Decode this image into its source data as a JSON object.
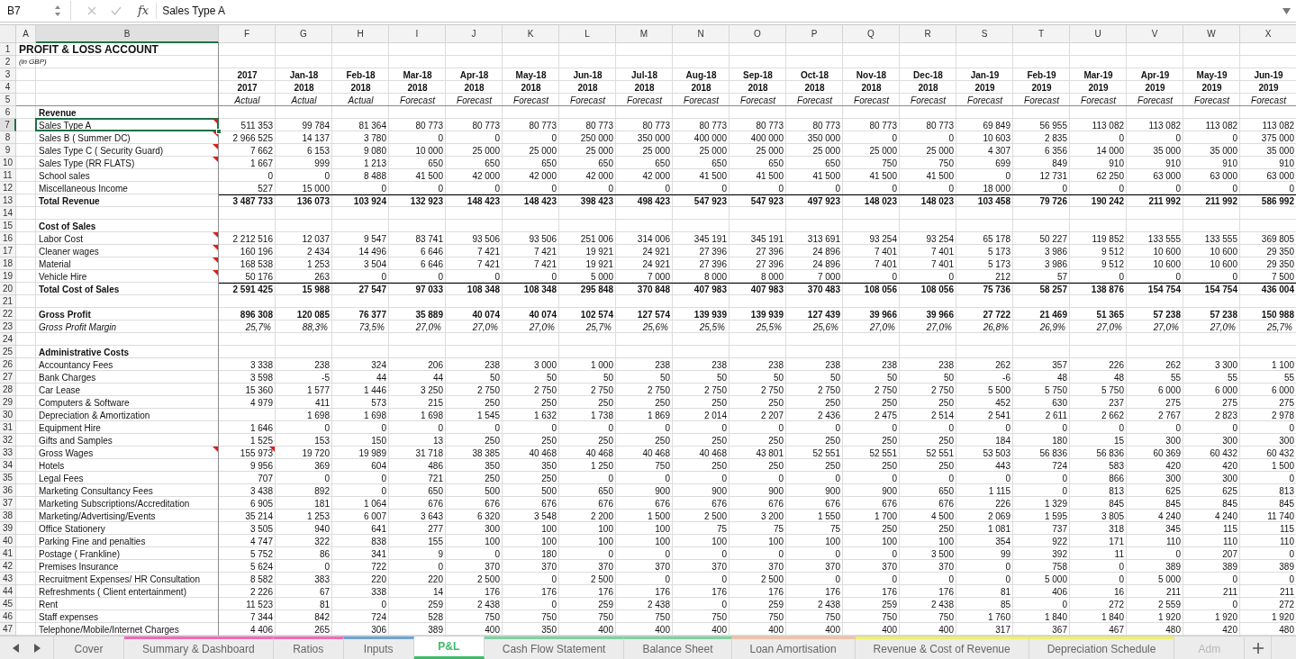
{
  "formula_bar": {
    "cell_reference": "B7",
    "function_label": "fx",
    "formula": "Sales Type A"
  },
  "columns": [
    {
      "label": "A",
      "selected": false
    },
    {
      "label": "B",
      "selected": true
    },
    {
      "label": "F",
      "selected": false
    },
    {
      "label": "G",
      "selected": false
    },
    {
      "label": "H",
      "selected": false
    },
    {
      "label": "I",
      "selected": false
    },
    {
      "label": "J",
      "selected": false
    },
    {
      "label": "K",
      "selected": false
    },
    {
      "label": "L",
      "selected": false
    },
    {
      "label": "M",
      "selected": false
    },
    {
      "label": "N",
      "selected": false
    },
    {
      "label": "O",
      "selected": false
    },
    {
      "label": "P",
      "selected": false
    },
    {
      "label": "Q",
      "selected": false
    },
    {
      "label": "R",
      "selected": false
    },
    {
      "label": "S",
      "selected": false
    },
    {
      "label": "T",
      "selected": false
    },
    {
      "label": "U",
      "selected": false
    },
    {
      "label": "V",
      "selected": false
    },
    {
      "label": "W",
      "selected": false
    },
    {
      "label": "X",
      "selected": false
    }
  ],
  "rows": [
    {
      "number": "1",
      "kind": "title",
      "label": "PROFIT & LOSS ACCOUNT",
      "comment": false,
      "selected": false
    },
    {
      "number": "2",
      "kind": "note",
      "label": "(in GBP)",
      "comment": false,
      "selected": false
    },
    {
      "number": "3",
      "kind": "period",
      "comment": false,
      "selected": false,
      "cells": [
        "2017",
        "Jan-18",
        "Feb-18",
        "Mar-18",
        "Apr-18",
        "May-18",
        "Jun-18",
        "Jul-18",
        "Aug-18",
        "Sep-18",
        "Oct-18",
        "Nov-18",
        "Dec-18",
        "Jan-19",
        "Feb-19",
        "Mar-19",
        "Apr-19",
        "May-19",
        "Jun-19"
      ]
    },
    {
      "number": "4",
      "kind": "period",
      "comment": false,
      "selected": false,
      "cells": [
        "2017",
        "2018",
        "2018",
        "2018",
        "2018",
        "2018",
        "2018",
        "2018",
        "2018",
        "2018",
        "2018",
        "2018",
        "2018",
        "2019",
        "2019",
        "2019",
        "2019",
        "2019",
        "2019"
      ]
    },
    {
      "number": "5",
      "kind": "basis",
      "comment": false,
      "selected": false,
      "cells": [
        "Actual",
        "Actual",
        "Actual",
        "Forecast",
        "Forecast",
        "Forecast",
        "Forecast",
        "Forecast",
        "Forecast",
        "Forecast",
        "Forecast",
        "Forecast",
        "Forecast",
        "Forecast",
        "Forecast",
        "Forecast",
        "Forecast",
        "Forecast",
        "Forecast"
      ]
    },
    {
      "number": "6",
      "kind": "section",
      "label": "Revenue",
      "comment": false,
      "selected": false
    },
    {
      "number": "7",
      "kind": "item",
      "label": "Sales Type A",
      "comment": true,
      "selected": true,
      "cells": [
        "511 353",
        "99 784",
        "81 364",
        "80 773",
        "80 773",
        "80 773",
        "80 773",
        "80 773",
        "80 773",
        "80 773",
        "80 773",
        "80 773",
        "80 773",
        "69 849",
        "56 955",
        "113 082",
        "113 082",
        "113 082",
        "113 082"
      ]
    },
    {
      "number": "8",
      "kind": "item",
      "label": "Sales B ( Summer DC)",
      "comment": true,
      "selected": false,
      "cells": [
        "2 966 525",
        "14 137",
        "3 780",
        "0",
        "0",
        "0",
        "250 000",
        "350 000",
        "400 000",
        "400 000",
        "350 000",
        "0",
        "0",
        "10 603",
        "2 835",
        "0",
        "0",
        "0",
        "375 000"
      ]
    },
    {
      "number": "9",
      "kind": "item",
      "label": "Sales Type C ( Security Guard)",
      "comment": true,
      "selected": false,
      "cells": [
        "7 662",
        "6 153",
        "9 080",
        "10 000",
        "25 000",
        "25 000",
        "25 000",
        "25 000",
        "25 000",
        "25 000",
        "25 000",
        "25 000",
        "25 000",
        "4 307",
        "6 356",
        "14 000",
        "35 000",
        "35 000",
        "35 000"
      ]
    },
    {
      "number": "10",
      "kind": "item",
      "label": "Sales Type (RR FLATS)",
      "comment": true,
      "selected": false,
      "cells": [
        "1 667",
        "999",
        "1 213",
        "650",
        "650",
        "650",
        "650",
        "650",
        "650",
        "650",
        "650",
        "750",
        "750",
        "699",
        "849",
        "910",
        "910",
        "910",
        "910"
      ]
    },
    {
      "number": "11",
      "kind": "item",
      "label": "School sales",
      "comment": false,
      "selected": false,
      "cells": [
        "0",
        "0",
        "8 488",
        "41 500",
        "42 000",
        "42 000",
        "42 000",
        "42 000",
        "41 500",
        "41 500",
        "41 500",
        "41 500",
        "41 500",
        "0",
        "12 731",
        "62 250",
        "63 000",
        "63 000",
        "63 000"
      ]
    },
    {
      "number": "12",
      "kind": "item",
      "label": "Miscellaneous Income",
      "comment": false,
      "selected": false,
      "cells": [
        "527",
        "15 000",
        "0",
        "0",
        "0",
        "0",
        "0",
        "0",
        "0",
        "0",
        "0",
        "0",
        "0",
        "18 000",
        "0",
        "0",
        "0",
        "0",
        "0"
      ]
    },
    {
      "number": "13",
      "kind": "total",
      "label": "Total Revenue",
      "comment": false,
      "selected": false,
      "cells": [
        "3 487 733",
        "136 073",
        "103 924",
        "132 923",
        "148 423",
        "148 423",
        "398 423",
        "498 423",
        "547 923",
        "547 923",
        "497 923",
        "148 023",
        "148 023",
        "103 458",
        "79 726",
        "190 242",
        "211 992",
        "211 992",
        "586 992"
      ]
    },
    {
      "number": "14",
      "kind": "blank",
      "comment": false,
      "selected": false
    },
    {
      "number": "15",
      "kind": "section",
      "label": "Cost of Sales",
      "comment": false,
      "selected": false
    },
    {
      "number": "16",
      "kind": "item",
      "label": "Labor Cost",
      "comment": true,
      "selected": false,
      "cells": [
        "2 212 516",
        "12 037",
        "9 547",
        "83 741",
        "93 506",
        "93 506",
        "251 006",
        "314 006",
        "345 191",
        "345 191",
        "313 691",
        "93 254",
        "93 254",
        "65 178",
        "50 227",
        "119 852",
        "133 555",
        "133 555",
        "369 805"
      ]
    },
    {
      "number": "17",
      "kind": "item",
      "label": "Cleaner wages",
      "comment": true,
      "selected": false,
      "cells": [
        "160 196",
        "2 434",
        "14 496",
        "6 646",
        "7 421",
        "7 421",
        "19 921",
        "24 921",
        "27 396",
        "27 396",
        "24 896",
        "7 401",
        "7 401",
        "5 173",
        "3 986",
        "9 512",
        "10 600",
        "10 600",
        "29 350"
      ]
    },
    {
      "number": "18",
      "kind": "item",
      "label": "Material",
      "comment": true,
      "selected": false,
      "cells": [
        "168 538",
        "1 253",
        "3 504",
        "6 646",
        "7 421",
        "7 421",
        "19 921",
        "24 921",
        "27 396",
        "27 396",
        "24 896",
        "7 401",
        "7 401",
        "5 173",
        "3 986",
        "9 512",
        "10 600",
        "10 600",
        "29 350"
      ]
    },
    {
      "number": "19",
      "kind": "item",
      "label": "Vehicle Hire",
      "comment": true,
      "selected": false,
      "cells": [
        "50 176",
        "263",
        "0",
        "0",
        "0",
        "0",
        "5 000",
        "7 000",
        "8 000",
        "8 000",
        "7 000",
        "0",
        "0",
        "212",
        "57",
        "0",
        "0",
        "0",
        "7 500"
      ]
    },
    {
      "number": "20",
      "kind": "total",
      "label": "Total Cost of Sales",
      "comment": false,
      "selected": false,
      "cells": [
        "2 591 425",
        "15 988",
        "27 547",
        "97 033",
        "108 348",
        "108 348",
        "295 848",
        "370 848",
        "407 983",
        "407 983",
        "370 483",
        "108 056",
        "108 056",
        "75 736",
        "58 257",
        "138 876",
        "154 754",
        "154 754",
        "436 004"
      ]
    },
    {
      "number": "21",
      "kind": "blank",
      "comment": false,
      "selected": false
    },
    {
      "number": "22",
      "kind": "subtotal",
      "label": "Gross Profit",
      "comment": false,
      "selected": false,
      "cells": [
        "896 308",
        "120 085",
        "76 377",
        "35 889",
        "40 074",
        "40 074",
        "102 574",
        "127 574",
        "139 939",
        "139 939",
        "127 439",
        "39 966",
        "39 966",
        "27 722",
        "21 469",
        "51 365",
        "57 238",
        "57 238",
        "150 988"
      ]
    },
    {
      "number": "23",
      "kind": "ratio",
      "label": "Gross Profit Margin",
      "comment": false,
      "selected": false,
      "cells": [
        "25,7%",
        "88,3%",
        "73,5%",
        "27,0%",
        "27,0%",
        "27,0%",
        "25,7%",
        "25,6%",
        "25,5%",
        "25,5%",
        "25,6%",
        "27,0%",
        "27,0%",
        "26,8%",
        "26,9%",
        "27,0%",
        "27,0%",
        "27,0%",
        "25,7%"
      ]
    },
    {
      "number": "24",
      "kind": "blank",
      "comment": false,
      "selected": false
    },
    {
      "number": "25",
      "kind": "section",
      "label": "Administrative Costs",
      "comment": false,
      "selected": false
    },
    {
      "number": "26",
      "kind": "item",
      "label": "Accountancy Fees",
      "comment": false,
      "selected": false,
      "cells": [
        "3 338",
        "238",
        "324",
        "206",
        "238",
        "3 000",
        "1 000",
        "238",
        "238",
        "238",
        "238",
        "238",
        "238",
        "262",
        "357",
        "226",
        "262",
        "3 300",
        "1 100"
      ]
    },
    {
      "number": "27",
      "kind": "item",
      "label": "Bank Charges",
      "comment": false,
      "selected": false,
      "cells": [
        "3 598",
        "-5",
        "44",
        "44",
        "50",
        "50",
        "50",
        "50",
        "50",
        "50",
        "50",
        "50",
        "50",
        "-6",
        "48",
        "48",
        "55",
        "55",
        "55"
      ]
    },
    {
      "number": "28",
      "kind": "item",
      "label": "Car Lease",
      "comment": false,
      "selected": false,
      "cells": [
        "15 360",
        "1 577",
        "1 446",
        "3 250",
        "2 750",
        "2 750",
        "2 750",
        "2 750",
        "2 750",
        "2 750",
        "2 750",
        "2 750",
        "2 750",
        "5 500",
        "5 750",
        "5 750",
        "6 000",
        "6 000",
        "6 000"
      ]
    },
    {
      "number": "29",
      "kind": "item",
      "label": "Computers & Software",
      "comment": false,
      "selected": false,
      "cells": [
        "4 979",
        "411",
        "573",
        "215",
        "250",
        "250",
        "250",
        "250",
        "250",
        "250",
        "250",
        "250",
        "250",
        "452",
        "630",
        "237",
        "275",
        "275",
        "275"
      ]
    },
    {
      "number": "30",
      "kind": "item",
      "label": "Depreciation & Amortization",
      "comment": false,
      "selected": false,
      "cells": [
        null,
        "1 698",
        "1 698",
        "1 698",
        "1 545",
        "1 632",
        "1 738",
        "1 869",
        "2 014",
        "2 207",
        "2 436",
        "2 475",
        "2 514",
        "2 541",
        "2 611",
        "2 662",
        "2 767",
        "2 823",
        "2 978"
      ]
    },
    {
      "number": "31",
      "kind": "item",
      "label": "Equipment Hire",
      "comment": false,
      "selected": false,
      "cells": [
        "1 646",
        "0",
        "0",
        "0",
        "0",
        "0",
        "0",
        "0",
        "0",
        "0",
        "0",
        "0",
        "0",
        "0",
        "0",
        "0",
        "0",
        "0",
        "0"
      ]
    },
    {
      "number": "32",
      "kind": "item",
      "label": "Gifts and Samples",
      "comment": false,
      "selected": false,
      "cells": [
        "1 525",
        "153",
        "150",
        "13",
        "250",
        "250",
        "250",
        "250",
        "250",
        "250",
        "250",
        "250",
        "250",
        "184",
        "180",
        "15",
        "300",
        "300",
        "300"
      ]
    },
    {
      "number": "33",
      "kind": "item",
      "label": "Gross Wages",
      "comment": true,
      "selected": false,
      "cells": [
        {
          "text": "155 973",
          "comment": true
        },
        "19 720",
        "19 989",
        "31 718",
        "38 385",
        "40 468",
        "40 468",
        "40 468",
        "40 468",
        "43 801",
        "52 551",
        "52 551",
        "52 551",
        "53 503",
        "56 836",
        "56 836",
        "60 369",
        "60 432",
        "60 432"
      ]
    },
    {
      "number": "34",
      "kind": "item",
      "label": "Hotels",
      "comment": false,
      "selected": false,
      "cells": [
        "9 956",
        "369",
        "604",
        "486",
        "350",
        "350",
        "1 250",
        "750",
        "250",
        "250",
        "250",
        "250",
        "250",
        "443",
        "724",
        "583",
        "420",
        "420",
        "1 500"
      ]
    },
    {
      "number": "35",
      "kind": "item",
      "label": "Legal Fees",
      "comment": false,
      "selected": false,
      "cells": [
        "707",
        "0",
        "0",
        "721",
        "250",
        "250",
        "0",
        "0",
        "0",
        "0",
        "0",
        "0",
        "0",
        "0",
        "0",
        "866",
        "300",
        "300",
        "0"
      ]
    },
    {
      "number": "36",
      "kind": "item",
      "label": "Marketing Consultancy Fees",
      "comment": false,
      "selected": false,
      "cells": [
        "3 438",
        "892",
        "0",
        "650",
        "500",
        "500",
        "650",
        "900",
        "900",
        "900",
        "900",
        "900",
        "650",
        "1 115",
        "0",
        "813",
        "625",
        "625",
        "813"
      ]
    },
    {
      "number": "37",
      "kind": "item",
      "label": "Marketing Subscriptions/Accreditation",
      "comment": false,
      "selected": false,
      "cells": [
        "6 905",
        "181",
        "1 064",
        "676",
        "676",
        "676",
        "676",
        "676",
        "676",
        "676",
        "676",
        "676",
        "676",
        "226",
        "1 329",
        "845",
        "845",
        "845",
        "845"
      ]
    },
    {
      "number": "38",
      "kind": "item",
      "label": "Marketing/Advertising/Events",
      "comment": false,
      "selected": false,
      "cells": [
        "35 214",
        "1 253",
        "6 007",
        "3 643",
        "6 320",
        "3 548",
        "2 200",
        "1 500",
        "2 500",
        "3 200",
        "1 550",
        "1 700",
        "4 500",
        "2 069",
        "1 595",
        "3 805",
        "4 240",
        "4 240",
        "11 740"
      ]
    },
    {
      "number": "39",
      "kind": "item",
      "label": "Office Stationery",
      "comment": false,
      "selected": false,
      "cells": [
        "3 505",
        "940",
        "641",
        "277",
        "300",
        "100",
        "100",
        "100",
        "75",
        "75",
        "75",
        "250",
        "250",
        "1 081",
        "737",
        "318",
        "345",
        "115",
        "115"
      ]
    },
    {
      "number": "40",
      "kind": "item",
      "label": "Parking Fine and penalties",
      "comment": false,
      "selected": false,
      "cells": [
        "4 747",
        "322",
        "838",
        "155",
        "100",
        "100",
        "100",
        "100",
        "100",
        "100",
        "100",
        "100",
        "100",
        "354",
        "922",
        "171",
        "110",
        "110",
        "110"
      ]
    },
    {
      "number": "41",
      "kind": "item",
      "label": "Postage ( Frankline)",
      "comment": false,
      "selected": false,
      "cells": [
        "5 752",
        "86",
        "341",
        "9",
        "0",
        "180",
        "0",
        "0",
        "0",
        "0",
        "0",
        "0",
        "3 500",
        "99",
        "392",
        "11",
        "0",
        "207",
        "0"
      ]
    },
    {
      "number": "42",
      "kind": "item",
      "label": "Premises Insurance",
      "comment": false,
      "selected": false,
      "cells": [
        "5 624",
        "0",
        "722",
        "0",
        "370",
        "370",
        "370",
        "370",
        "370",
        "370",
        "370",
        "370",
        "370",
        "0",
        "758",
        "0",
        "389",
        "389",
        "389"
      ]
    },
    {
      "number": "43",
      "kind": "item",
      "label": "Recruitment Expenses/ HR Consultation",
      "comment": false,
      "selected": false,
      "cells": [
        "8 582",
        "383",
        "220",
        "220",
        "2 500",
        "0",
        "2 500",
        "0",
        "0",
        "2 500",
        "0",
        "0",
        "0",
        "0",
        "5 000",
        "0",
        "5 000",
        "0",
        "0"
      ]
    },
    {
      "number": "44",
      "kind": "item",
      "label": "Refreshments ( Client entertainment)",
      "comment": false,
      "selected": false,
      "cells": [
        "2 226",
        "67",
        "338",
        "14",
        "176",
        "176",
        "176",
        "176",
        "176",
        "176",
        "176",
        "176",
        "176",
        "81",
        "406",
        "16",
        "211",
        "211",
        "211"
      ]
    },
    {
      "number": "45",
      "kind": "item",
      "label": "Rent",
      "comment": false,
      "selected": false,
      "cells": [
        "11 523",
        "81",
        "0",
        "259",
        "2 438",
        "0",
        "259",
        "2 438",
        "0",
        "259",
        "2 438",
        "259",
        "2 438",
        "85",
        "0",
        "272",
        "2 559",
        "0",
        "272"
      ]
    },
    {
      "number": "46",
      "kind": "item",
      "label": "Staff expenses",
      "comment": false,
      "selected": false,
      "cells": [
        "7 344",
        "842",
        "724",
        "528",
        "750",
        "750",
        "750",
        "750",
        "750",
        "750",
        "750",
        "750",
        "750",
        "1 760",
        "1 840",
        "1 840",
        "1 920",
        "1 920",
        "1 920"
      ]
    },
    {
      "number": "47",
      "kind": "item",
      "label": "Telephone/Mobile/Internet Charges",
      "comment": false,
      "selected": false,
      "cells": [
        "4 406",
        "265",
        "306",
        "389",
        "400",
        "350",
        "400",
        "400",
        "400",
        "400",
        "400",
        "400",
        "400",
        "317",
        "367",
        "467",
        "480",
        "420",
        "480"
      ]
    }
  ],
  "sheet_tabs": [
    {
      "label": "Cover",
      "selected": false
    },
    {
      "label": "Summary & Dashboard",
      "selected": false,
      "color": "#f06cb4"
    },
    {
      "label": "Ratios",
      "selected": false,
      "color": "#f06cb4"
    },
    {
      "label": "Inputs",
      "selected": false,
      "color": "#6fa3d8"
    },
    {
      "label": "P&L",
      "selected": true,
      "color": "#3dbb6a"
    },
    {
      "label": "Cash Flow Statement",
      "selected": false,
      "color": "#7dd3a0"
    },
    {
      "label": "Balance Sheet",
      "selected": false,
      "color": "#7dd3a0"
    },
    {
      "label": "Loan Amortisation",
      "selected": false,
      "color": "#f5c0a8"
    },
    {
      "label": "Revenue & Cost of Revenue",
      "selected": false,
      "color": "#eef06a"
    },
    {
      "label": "Depreciation Schedule",
      "selected": false,
      "color": "#eef06a"
    },
    {
      "label": "Adm",
      "selected": false
    }
  ]
}
